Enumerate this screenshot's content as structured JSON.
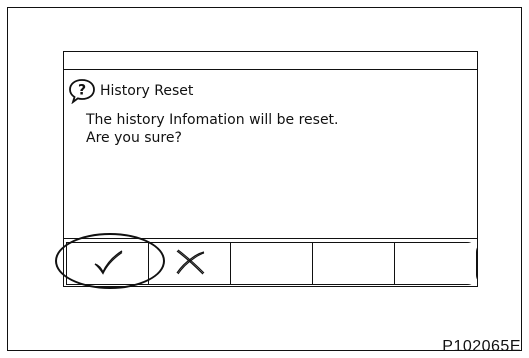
{
  "dialog": {
    "title": "History Reset",
    "title_icon": "question-bubble-icon",
    "message_lines": [
      "The history Infomation will be reset.",
      "Are you sure?"
    ],
    "buttons": [
      {
        "name": "confirm-button",
        "icon": "check-icon"
      },
      {
        "name": "cancel-button",
        "icon": "x-icon"
      },
      {
        "name": "empty-button-3",
        "icon": ""
      },
      {
        "name": "empty-button-4",
        "icon": ""
      },
      {
        "name": "empty-button-5",
        "icon": ""
      }
    ]
  },
  "figure_code": "P102065E"
}
